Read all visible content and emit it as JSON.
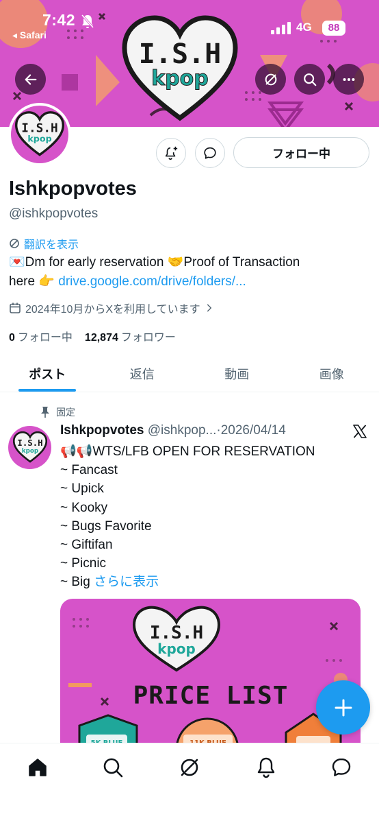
{
  "status_bar": {
    "time": "7:42",
    "back_app": "◂ Safari",
    "network": "4G",
    "battery": "88"
  },
  "banner": {
    "logo_text": "I.S.H",
    "logo_subtext": "kpop"
  },
  "top_actions": {
    "back_icon": "arrow-left-icon",
    "grok_icon": "grok-icon",
    "search_icon": "search-icon",
    "more_icon": "more-icon"
  },
  "profile": {
    "follow_label": "フォロー中",
    "display_name": "Ishkpopvotes",
    "handle": "@ishkpopvotes",
    "translate_label": "翻訳を表示",
    "bio_line1": "💌Dm for early reservation 🤝Proof of Transaction",
    "bio_line2_prefix": "here 👉 ",
    "bio_link": "drive.google.com/drive/folders/...",
    "joined": "2024年10月からXを利用しています",
    "following_count": "0",
    "following_label": "フォロー中",
    "followers_count": "12,874",
    "followers_label": "フォロワー"
  },
  "tabs": [
    {
      "label": "ポスト"
    },
    {
      "label": "返信"
    },
    {
      "label": "動画"
    },
    {
      "label": "画像"
    }
  ],
  "tweet": {
    "pinned_label": "固定",
    "name": "Ishkpopvotes",
    "handle": "@ishkpop...",
    "separator": "·",
    "date": "2026/04/14",
    "lines": [
      "📢📢WTS/LFB OPEN FOR RESERVATION",
      "~ Fancast",
      "~ Upick",
      "~ Kooky",
      "~ Bugs Favorite",
      "~ Giftifan",
      "~ Picnic"
    ],
    "last_line": "~ Big ",
    "more_label": "さらに表示",
    "image_title": "PRICE LIST",
    "image_logo_text": "I.S.H",
    "image_logo_subtext": "kpop",
    "image_badge_left": "5K BLUE",
    "image_badge_mid": "11K BLUE"
  },
  "colors": {
    "banner_pink": "#d653c9",
    "x_blue": "#1d9bf0",
    "text_primary": "#0f1419",
    "text_secondary": "#536471"
  }
}
